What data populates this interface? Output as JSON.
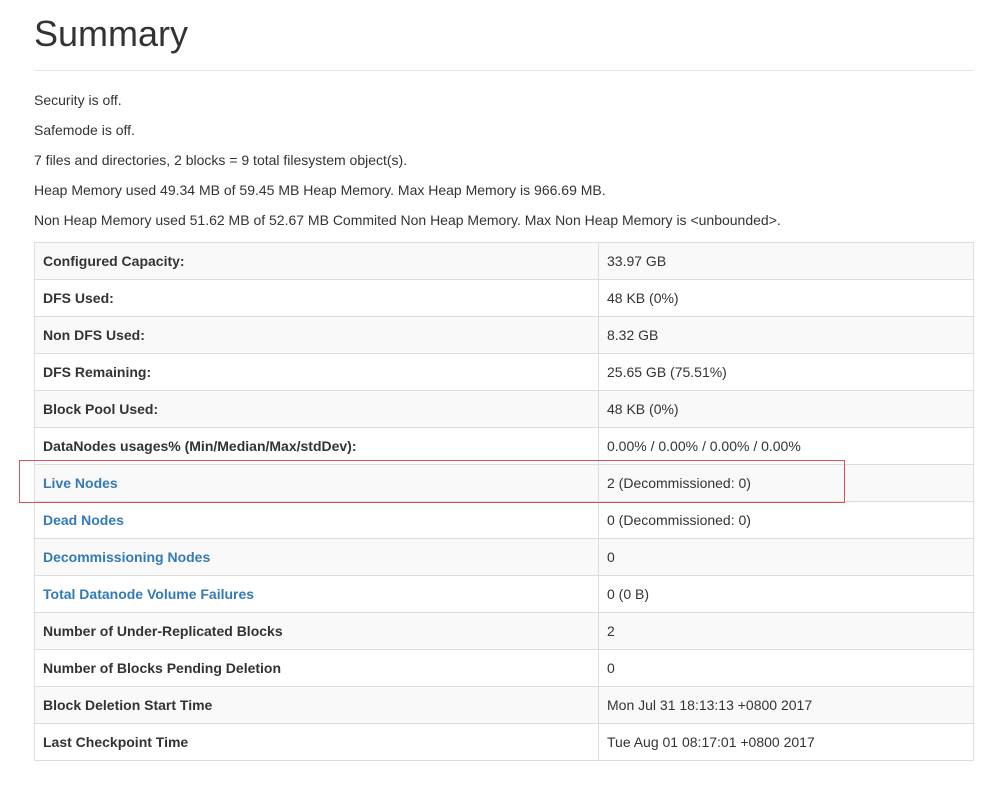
{
  "page": {
    "title": "Summary"
  },
  "info_lines": [
    "Security is off.",
    "Safemode is off.",
    "7 files and directories, 2 blocks = 9 total filesystem object(s).",
    "Heap Memory used 49.34 MB of 59.45 MB Heap Memory. Max Heap Memory is 966.69 MB.",
    "Non Heap Memory used 51.62 MB of 52.67 MB Commited Non Heap Memory. Max Non Heap Memory is <unbounded>."
  ],
  "table": {
    "rows": [
      {
        "label": "Configured Capacity:",
        "value": "33.97 GB",
        "link": false
      },
      {
        "label": "DFS Used:",
        "value": "48 KB (0%)",
        "link": false
      },
      {
        "label": "Non DFS Used:",
        "value": "8.32 GB",
        "link": false
      },
      {
        "label": "DFS Remaining:",
        "value": "25.65 GB (75.51%)",
        "link": false
      },
      {
        "label": "Block Pool Used:",
        "value": "48 KB (0%)",
        "link": false
      },
      {
        "label": "DataNodes usages% (Min/Median/Max/stdDev):",
        "value": "0.00% / 0.00% / 0.00% / 0.00%",
        "link": false
      },
      {
        "label": "Live Nodes",
        "value": "2 (Decommissioned: 0)",
        "link": true
      },
      {
        "label": "Dead Nodes",
        "value": "0 (Decommissioned: 0)",
        "link": true
      },
      {
        "label": "Decommissioning Nodes",
        "value": "0",
        "link": true
      },
      {
        "label": "Total Datanode Volume Failures",
        "value": "0 (0 B)",
        "link": true
      },
      {
        "label": "Number of Under-Replicated Blocks",
        "value": "2",
        "link": false
      },
      {
        "label": "Number of Blocks Pending Deletion",
        "value": "0",
        "link": false
      },
      {
        "label": "Block Deletion Start Time",
        "value": "Mon Jul 31 18:13:13 +0800 2017",
        "link": false
      },
      {
        "label": "Last Checkpoint Time",
        "value": "Tue Aug 01 08:17:01 +0800 2017",
        "link": false
      }
    ]
  },
  "colors": {
    "link": "#337ab7",
    "highlight": "#d9534f",
    "text": "#333333"
  }
}
